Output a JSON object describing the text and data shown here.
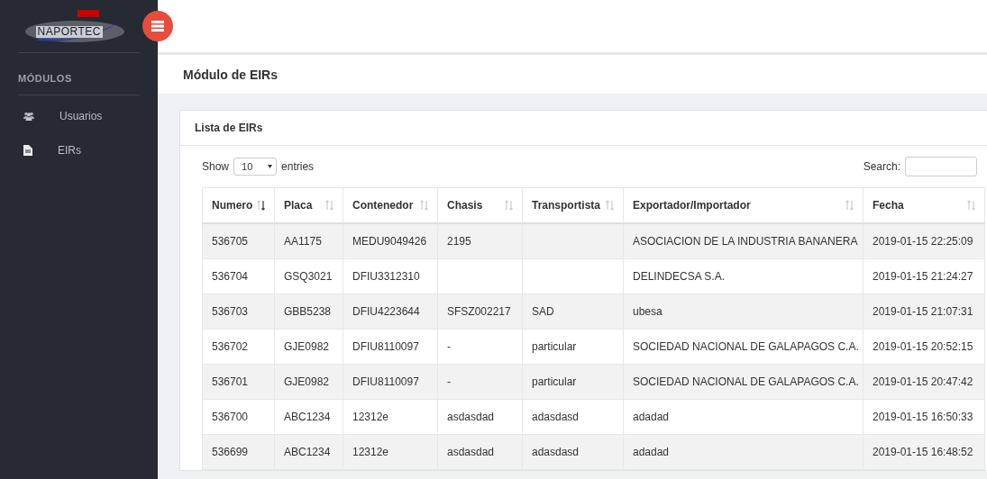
{
  "sidebar": {
    "logo": "NAPORTEC",
    "section_title": "MÓDULOS",
    "items": [
      {
        "label": "Usuarios",
        "kind": "users"
      },
      {
        "label": "EIRs",
        "kind": "file"
      }
    ]
  },
  "page_title": "Módulo de EIRs",
  "card": {
    "title": "Lista de EIRs",
    "show_label": "Show",
    "page_size": "10",
    "entries_label": "entries",
    "search_label": "Search:",
    "table": {
      "columns": [
        {
          "label": "Numero",
          "sorted": true
        },
        {
          "label": "Placa",
          "sorted": false
        },
        {
          "label": "Contenedor",
          "sorted": false
        },
        {
          "label": "Chasis",
          "sorted": false
        },
        {
          "label": "Transportista",
          "sorted": false
        },
        {
          "label": "Exportador/Importador",
          "sorted": false
        },
        {
          "label": "Fecha",
          "sorted": false
        }
      ],
      "rows": [
        [
          "536705",
          "AA1175",
          "MEDU9049426",
          "2195",
          "",
          "ASOCIACION DE LA INDUSTRIA BANANERA",
          "2019-01-15 22:25:09"
        ],
        [
          "536704",
          "GSQ3021",
          "DFIU3312310",
          "",
          "",
          "DELINDECSA S.A.",
          "2019-01-15 21:24:27"
        ],
        [
          "536703",
          "GBB5238",
          "DFIU4223644",
          "SFSZ002217",
          "SAD",
          "ubesa",
          "2019-01-15 21:07:31"
        ],
        [
          "536702",
          "GJE0982",
          "DFIU8110097",
          "-",
          "particular",
          "SOCIEDAD NACIONAL DE GALAPAGOS C.A.",
          "2019-01-15 20:52:15"
        ],
        [
          "536701",
          "GJE0982",
          "DFIU8110097",
          "-",
          "particular",
          "SOCIEDAD NACIONAL DE GALAPAGOS C.A.",
          "2019-01-15 20:47:42"
        ],
        [
          "536700",
          "ABC1234",
          "12312e",
          "asdasdad",
          "adasdasd",
          "adadad",
          "2019-01-15 16:50:33"
        ],
        [
          "536699",
          "ABC1234",
          "12312e",
          "asdasdad",
          "adasdasd",
          "adadad",
          "2019-01-15 16:48:52"
        ]
      ]
    }
  }
}
